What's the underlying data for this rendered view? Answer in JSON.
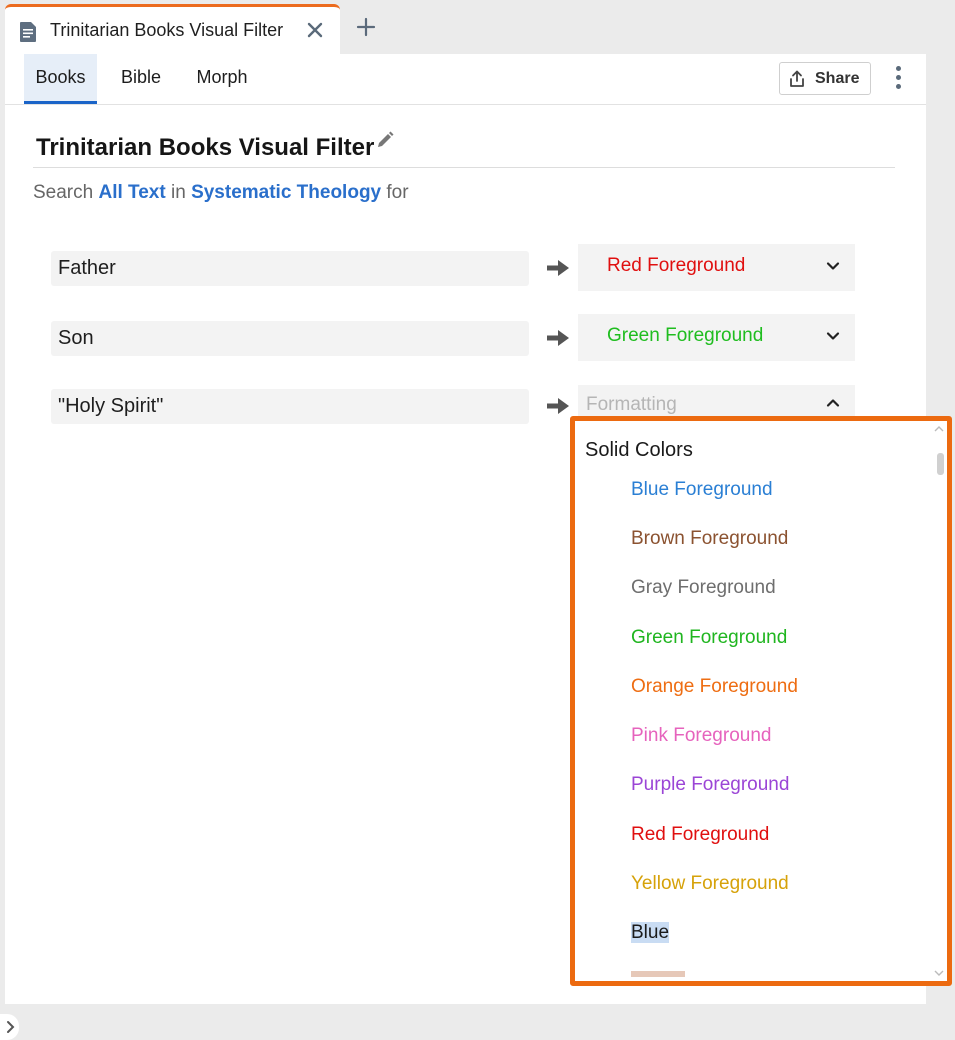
{
  "window": {
    "tab_title": "Trinitarian Books Visual Filter"
  },
  "subtabs": [
    {
      "label": "Books"
    },
    {
      "label": "Bible"
    },
    {
      "label": "Morph"
    }
  ],
  "toolbar": {
    "share_label": "Share"
  },
  "page": {
    "title": "Trinitarian Books Visual Filter",
    "search_prefix": "Search",
    "search_field": "All Text",
    "search_in": "in",
    "search_resource": "Systematic Theology",
    "search_suffix": "for"
  },
  "rules": [
    {
      "term": "Father",
      "format": "Red Foreground",
      "format_color": "#e00f0f"
    },
    {
      "term": "Son",
      "format": "Green Foreground",
      "format_color": "#1fbd1f"
    },
    {
      "term": "\"Holy Spirit\"",
      "format": "Formatting",
      "format_color": "#b5b5b5"
    }
  ],
  "dropdown": {
    "group_label": "Solid Colors",
    "options": [
      {
        "label": "Blue Foreground",
        "color": "#2a7fd4"
      },
      {
        "label": "Brown Foreground",
        "color": "#8b5230"
      },
      {
        "label": "Gray Foreground",
        "color": "#6e6e6e"
      },
      {
        "label": "Green Foreground",
        "color": "#1fb51f"
      },
      {
        "label": "Orange Foreground",
        "color": "#ee6d12"
      },
      {
        "label": "Pink Foreground",
        "color": "#e663bd"
      },
      {
        "label": "Purple Foreground",
        "color": "#9b45d6"
      },
      {
        "label": "Red Foreground",
        "color": "#e00f0f"
      },
      {
        "label": "Yellow Foreground",
        "color": "#d6a20a"
      },
      {
        "label": "Blue",
        "color": "#1a1a1a"
      }
    ]
  },
  "colors": {
    "accent": "#1a64c8",
    "tab_highlight": "#ec6b1e",
    "dropdown_border": "#ec6a10",
    "link": "#2a6fcb"
  },
  "icons": [
    "document-icon",
    "close-icon",
    "plus-icon",
    "share-icon",
    "more-vertical-icon",
    "pencil-icon",
    "arrow-right-icon",
    "chevron-down-icon",
    "chevron-up-icon"
  ]
}
